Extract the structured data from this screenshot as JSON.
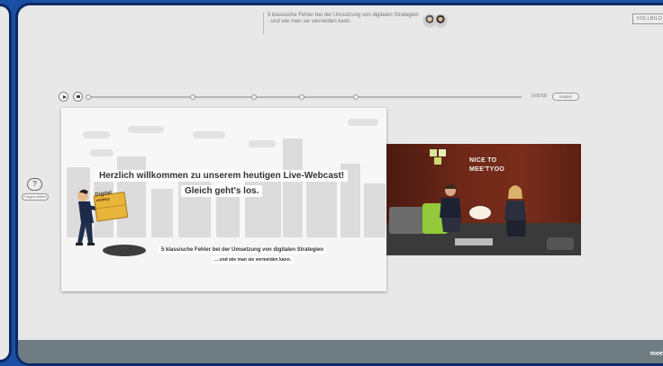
{
  "header": {
    "title": "5 klassische Fehler bei der Umsetzung von digitalen Strategien - und wie man sie vermeiden kann.",
    "fullscreen_label": "VOLLBILD"
  },
  "player": {
    "time": "0:00:58",
    "chapters_label": "Kapitel"
  },
  "slide": {
    "headline_1": "Herzlich willkommen zu unserem heutigen Live-Webcast!",
    "headline_2": "Gleich geht's los.",
    "sign_text_1": "Digital",
    "sign_text_2": "strategy",
    "subtitle_1": "5 klassische Fehler bei der Umsetzung von digitalen Strategien",
    "subtitle_2": "... und wie man sie vermeiden kann."
  },
  "video": {
    "logo_line_1": "NICE TO",
    "logo_line_2": "MEE'TYOO"
  },
  "sidebar": {
    "qa_icon": "?",
    "qa_label": "Fragen stellen"
  },
  "footer": {
    "brand": "meety"
  }
}
